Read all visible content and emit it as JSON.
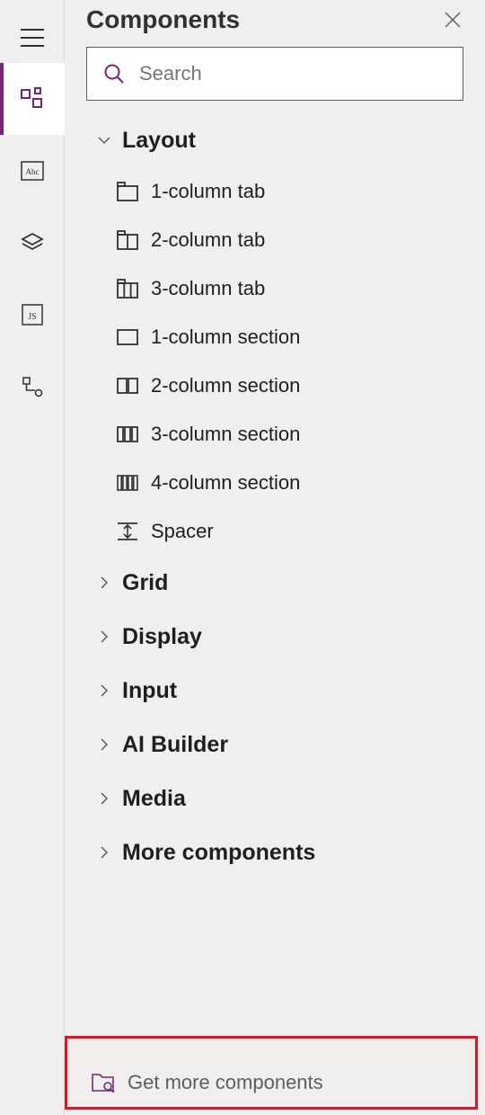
{
  "panel": {
    "title": "Components",
    "search_placeholder": "Search"
  },
  "groups": {
    "layout": "Layout",
    "grid": "Grid",
    "display": "Display",
    "input": "Input",
    "ai": "AI Builder",
    "media": "Media",
    "more": "More components"
  },
  "layout_items": {
    "col1tab": "1-column tab",
    "col2tab": "2-column tab",
    "col3tab": "3-column tab",
    "col1sec": "1-column section",
    "col2sec": "2-column section",
    "col3sec": "3-column section",
    "col4sec": "4-column section",
    "spacer": "Spacer"
  },
  "footer": {
    "get_more": "Get more components"
  }
}
